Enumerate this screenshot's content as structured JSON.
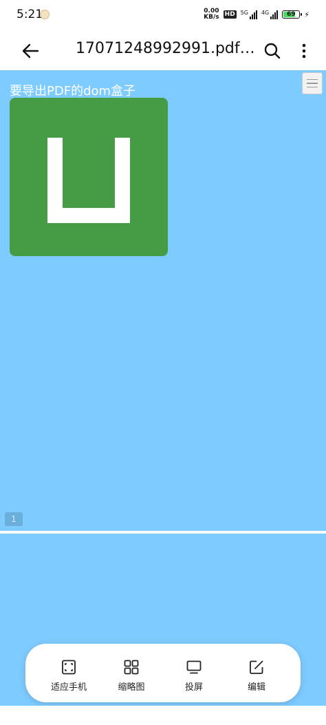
{
  "status_bar": {
    "time": "5:21",
    "net_speed_value": "0.00",
    "net_speed_unit": "KB/s",
    "hd_label": "HD",
    "signal1_label": "5G",
    "signal2_label": "4G",
    "battery_level": "69"
  },
  "app_bar": {
    "title": "17071248992991.pdf;fi..."
  },
  "document": {
    "heading": "要导出PDF的dom盒子",
    "page_number": "1"
  },
  "toolbar": {
    "items": [
      {
        "label": "适应手机",
        "icon": "fit-screen-icon"
      },
      {
        "label": "缩略图",
        "icon": "grid-icon"
      },
      {
        "label": "投屏",
        "icon": "monitor-icon"
      },
      {
        "label": "编辑",
        "icon": "edit-icon"
      }
    ]
  },
  "colors": {
    "viewer_background": "#7ecbff",
    "logo_green": "#469c44"
  }
}
